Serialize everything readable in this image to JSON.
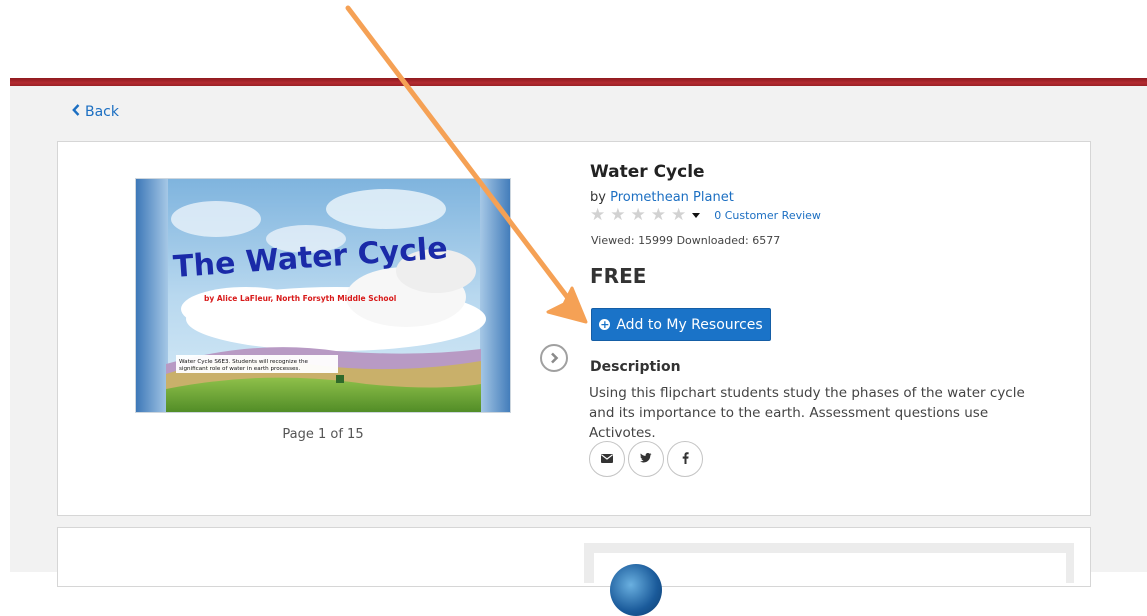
{
  "nav": {
    "back_label": "Back"
  },
  "preview": {
    "slide_title": "The Water Cycle",
    "slide_author": "by Alice LaFleur, North Forsyth Middle School",
    "slide_caption_line1": "Water Cycle  S6E3.  Students will recognize the",
    "slide_caption_line2": "significant role of water in earth processes.",
    "page_indicator": "Page 1 of 15"
  },
  "resource": {
    "title": "Water Cycle",
    "by_prefix": "by",
    "author": "Promethean Planet",
    "rating_stars": 0,
    "rating_max": 5,
    "review_link": "0 Customer Review",
    "viewed_label": "Viewed:",
    "viewed_count": "15999",
    "downloaded_label": "Downloaded:",
    "downloaded_count": "6577",
    "price": "FREE",
    "add_button_label": "Add to My Resources",
    "description_heading": "Description",
    "description_text": "Using this flipchart students study the phases of the water cycle and its importance to the earth.  Assessment questions use Activotes."
  },
  "social": {
    "email_icon": "envelope-icon",
    "twitter_icon": "twitter-icon",
    "facebook_icon": "facebook-icon"
  },
  "colors": {
    "accent": "#1a73c8",
    "header_red": "#a52429",
    "annotation_arrow": "#f5a155"
  }
}
